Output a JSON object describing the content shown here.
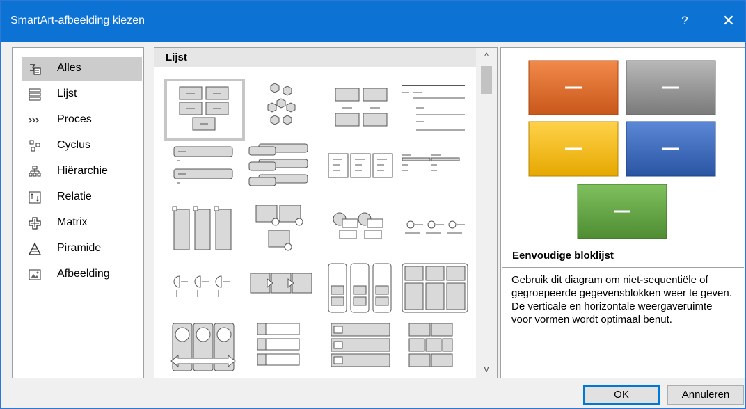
{
  "window": {
    "title": "SmartArt-afbeelding kiezen",
    "help_label": "?",
    "close_label": "✕"
  },
  "categories": [
    {
      "label": "Alles",
      "icon": "all-icon",
      "selected": true
    },
    {
      "label": "Lijst",
      "icon": "list-icon"
    },
    {
      "label": "Proces",
      "icon": "process-icon"
    },
    {
      "label": "Cyclus",
      "icon": "cycle-icon"
    },
    {
      "label": "Hiërarchie",
      "icon": "hierarchy-icon"
    },
    {
      "label": "Relatie",
      "icon": "relationship-icon"
    },
    {
      "label": "Matrix",
      "icon": "matrix-icon"
    },
    {
      "label": "Piramide",
      "icon": "pyramid-icon"
    },
    {
      "label": "Afbeelding",
      "icon": "picture-icon"
    }
  ],
  "gallery": {
    "section_label": "Lijst",
    "scroll_up": "^",
    "scroll_down": "v"
  },
  "preview": {
    "title": "Eenvoudige bloklijst",
    "description": "Gebruik dit diagram om niet-sequentiële of gegroepeerde gegevensblokken weer te geven. De verticale en horizontale weergaveruimte voor vormen wordt optimaal benut.",
    "placeholder": "—",
    "colors": {
      "orange": "#d4641f",
      "gray": "#8a8a8a",
      "yellow": "#f2b300",
      "blue": "#3060b0",
      "green": "#5f9e43"
    }
  },
  "buttons": {
    "ok": "OK",
    "cancel": "Annuleren"
  }
}
